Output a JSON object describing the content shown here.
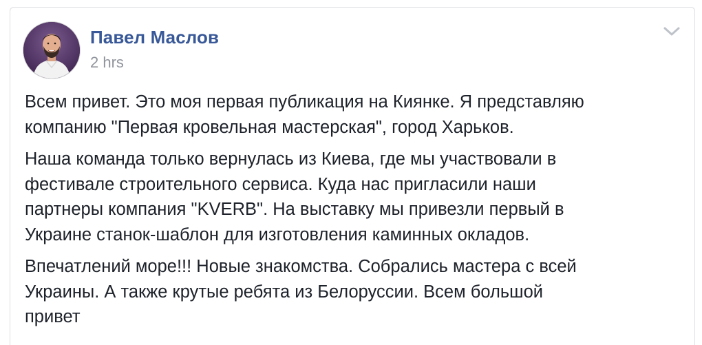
{
  "post": {
    "author": "Павел Маслов",
    "timestamp": "2 hrs",
    "menu_icon": "chevron-down-icon",
    "paragraphs": [
      [
        "Всем привет. Это моя первая публикация на Киянке. Я представляю",
        "компанию \"Первая кровельная мастерская\", город Харьков."
      ],
      [
        "Наша команда только вернулась из Киева, где мы участвовали в",
        "фестивале строительного сервиса. Куда нас пригласили наши",
        "партнеры компания \"KVERB\". На выставку мы привезли первый в",
        "Украине станок-шаблон для изготовления каминных окладов."
      ],
      [
        "Впечатлений море!!! Новые знакомства. Собрались мастера с всей",
        "Украины. А также крутые ребята из Белоруссии. Всем большой",
        "привет"
      ]
    ]
  },
  "colors": {
    "author_link": "#385898",
    "timestamp": "#90949c",
    "body_text": "#1d2129",
    "card_border": "#dddfe2"
  }
}
